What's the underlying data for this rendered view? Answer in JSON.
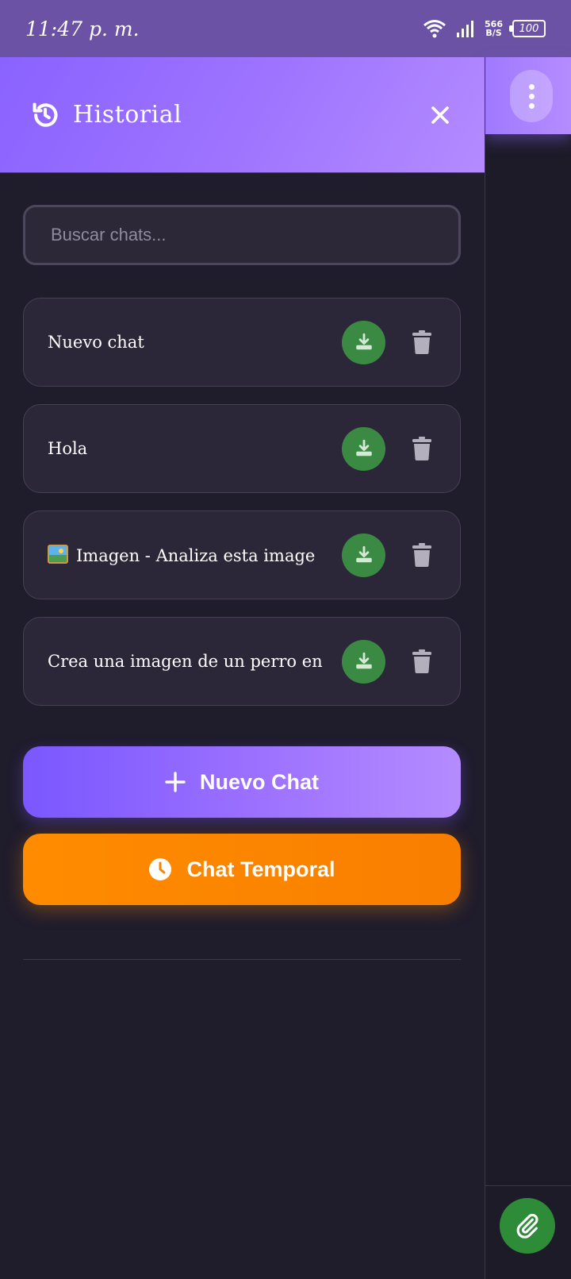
{
  "status_bar": {
    "time": "11:47 p. m.",
    "speed_value": "566",
    "speed_unit": "B/S",
    "battery": "100"
  },
  "drawer": {
    "title": "Historial",
    "search_placeholder": "Buscar chats...",
    "chats": [
      {
        "title": "Nuevo chat"
      },
      {
        "title": "Hola"
      },
      {
        "title": "Imagen - Analiza esta image",
        "emoji": "framed-picture-icon"
      },
      {
        "title": "Crea una imagen de un perro en"
      }
    ],
    "new_chat_label": "Nuevo Chat",
    "temp_chat_label": "Chat Temporal"
  },
  "colors": {
    "header_gradient": [
      "#8a62ff",
      "#b48bff"
    ],
    "download_button": "#3b8a44",
    "temp_button": "#ff8c00",
    "background": "#1f1c2c"
  }
}
